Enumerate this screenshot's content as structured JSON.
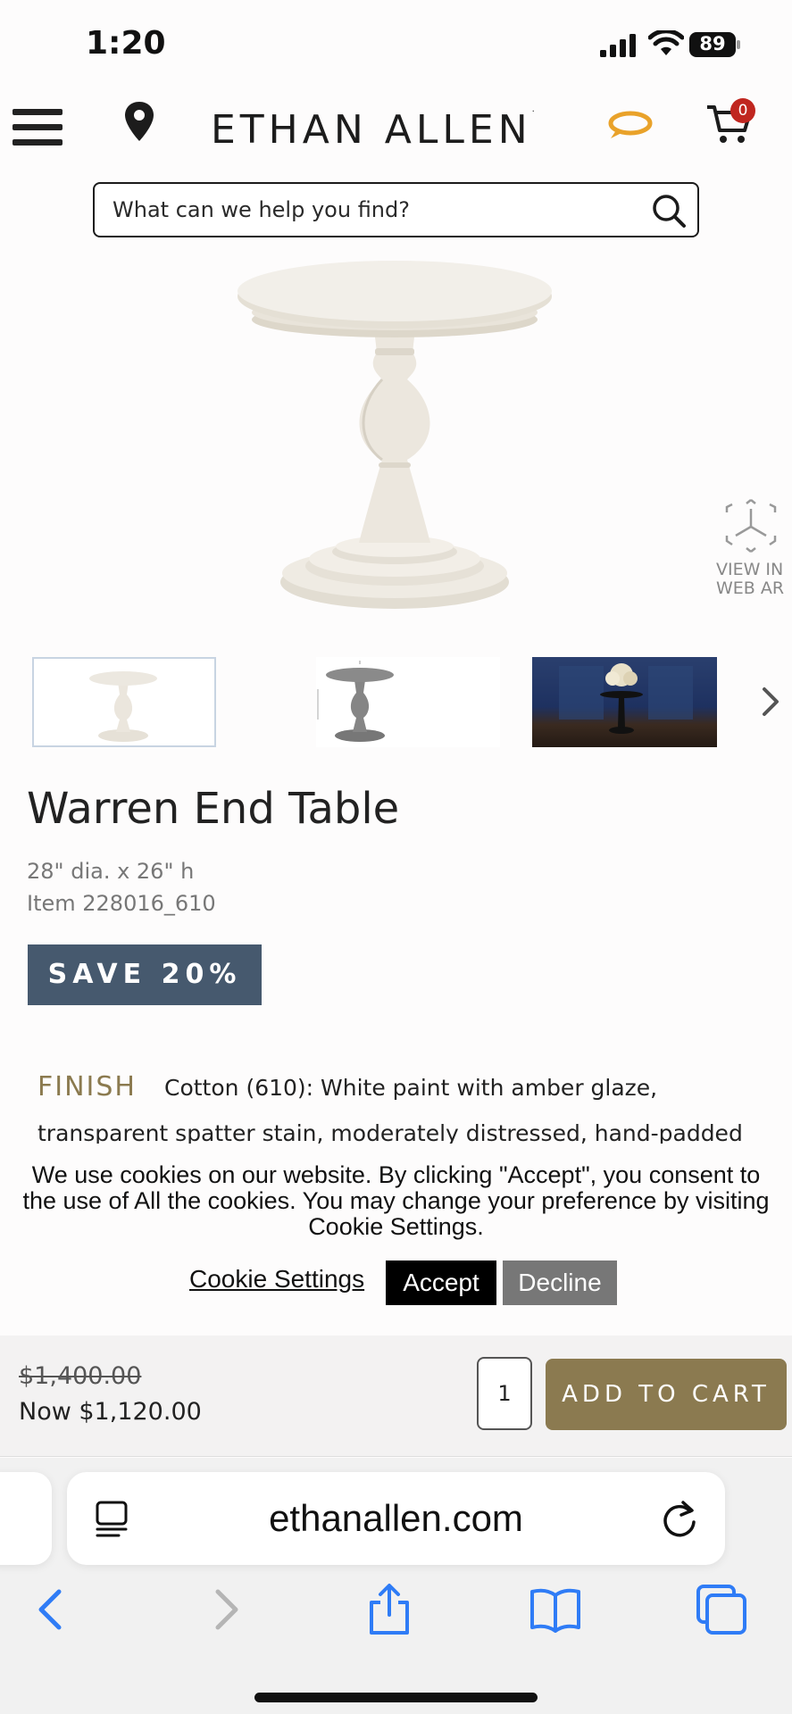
{
  "status_bar": {
    "time": "1:20",
    "battery": "89"
  },
  "header": {
    "logo": "ETHAN ALLEN",
    "cart_count": "0"
  },
  "search": {
    "placeholder": "What can we help you find?"
  },
  "ar": {
    "label_line1": "VIEW IN",
    "label_line2": "WEB AR"
  },
  "product": {
    "title": "Warren End Table",
    "dimensions": "28\" dia. x 26\" h",
    "item": "Item 228016_610",
    "badge": "SAVE 20%",
    "finish_label": "FINISH",
    "finish_line1": "Cotton (610): White paint with amber glaze,",
    "finish_line2": "transparent spatter stain, moderately distressed, hand-padded"
  },
  "cookie": {
    "message": "We use cookies on our website. By clicking \"Accept\", you consent to the use of All the cookies. You may change your preference by visiting Cookie Settings.",
    "settings_label": "Cookie Settings",
    "accept_label": "Accept",
    "decline_label": "Decline"
  },
  "cart_bar": {
    "old_price": "$1,400.00",
    "now_price": "Now $1,120.00",
    "quantity": "1",
    "add_label": "ADD TO CART"
  },
  "browser": {
    "url": "ethanallen.com"
  },
  "colors": {
    "badge": "#46596e",
    "accent_gold": "#8b7a50",
    "cart_badge": "#c0261f",
    "ios_blue": "#2f7cf6",
    "chat_icon": "#e9a22a"
  },
  "icons": {
    "menu": "hamburger-icon",
    "location": "map-pin-icon",
    "chat": "chat-bubble-icon",
    "cart": "cart-icon",
    "search": "search-icon",
    "ar": "cube-ar-icon",
    "next": "chevron-right-icon",
    "reader": "reader-icon",
    "reload": "reload-icon",
    "back": "back-icon",
    "forward": "forward-icon",
    "share": "share-icon",
    "bookmarks": "bookmarks-icon",
    "tabs": "tabs-icon"
  }
}
